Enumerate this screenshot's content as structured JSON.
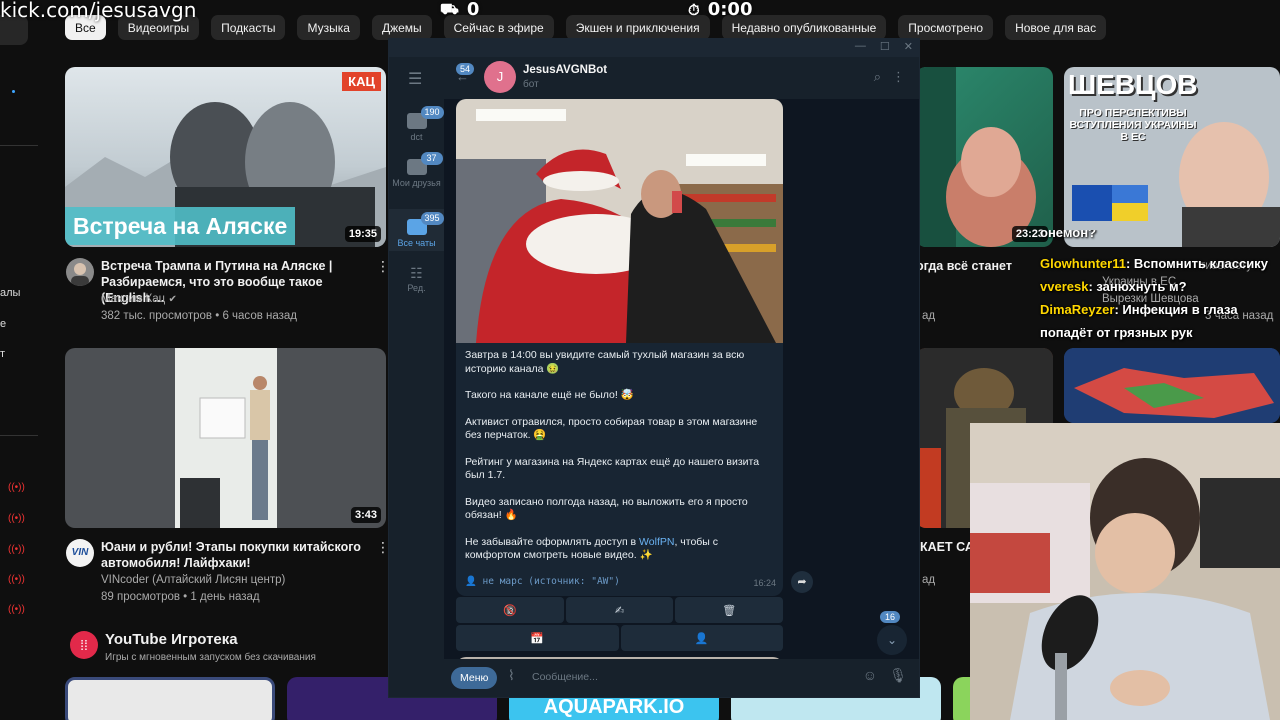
{
  "overlay": {
    "url": "kick.com/jesusavgn",
    "counter": "0",
    "timer": "0:00",
    "counter_icon": "user-icon",
    "timer_icon": "stopwatch-icon"
  },
  "yt": {
    "chips": [
      "Все",
      "Видеоигры",
      "Подкасты",
      "Музыка",
      "Джемы",
      "Сейчас в эфире",
      "Экшен и приключения",
      "Недавно опубликованные",
      "Просмотрено",
      "Новое для вас"
    ],
    "sidebar_frag": {
      "a": "алы",
      "b": "е",
      "c": "т"
    },
    "videos": [
      {
        "thumb_badge": "КАЦ",
        "thumb_caption": "Встреча на Аляске",
        "duration": "19:35",
        "title": "Встреча Трампа и Путина на Аляске | Разбираемся, что это вообще такое (English ...",
        "channel": "Максим Кац",
        "meta": "382 тыс. просмотров • 6 часов назад"
      },
      {
        "duration": "3:43",
        "title": "Юани и рубли! Этапы покупки китайского автомобиля! Лайфхаки!",
        "channel": "VINcoder (Алтайский Лисян центр)",
        "meta": "89 просмотров • 1 день назад"
      }
    ],
    "right": {
      "duration": "23:23",
      "thumb_title": "ШЕВЦОВ",
      "thumb_sub": "ПРО ПЕРСПЕКТИВЫ ВСТУПЛЕНИЯ УКРАИНЫ В ЕС",
      "frag_title": "огда всё станет",
      "frag_meta": "ад",
      "frag2": "тивы всту",
      "frag2b": "Украины в ЕС",
      "channel": "Вырезки Шевцова",
      "meta": "3 часа назад",
      "frag3": "КАЕТ СА",
      "frag3_meta": "ад"
    },
    "playables": {
      "title": "YouTube Игротека",
      "subtitle": "Игры с мгновенным запуском без скачивания",
      "tiles": [
        "",
        "",
        "AQUAPARK.IO",
        "",
        ""
      ]
    }
  },
  "telegram": {
    "rail": [
      {
        "label": "dct",
        "badge": "190"
      },
      {
        "label": "Мои друзья",
        "badge": "37"
      },
      {
        "label": "Все чаты",
        "badge": "395"
      },
      {
        "label": "Ред.",
        "badge": ""
      }
    ],
    "back_badge": "54",
    "bot": {
      "initial": "J",
      "name": "JesusAVGNBot",
      "status": "бот"
    },
    "message": {
      "p1": "Завтра в 14:00 вы увидите самый тухлый магазин за всю историю канала 🤢",
      "p2": "Такого на канале ещё не было! 🤯",
      "p3": "Активист отравился, просто собирая товар в этом магазине без перчаток. 🤮",
      "p4": "Рейтинг у магазина на Яндекс картах ещё до нашего визита был 1.7.",
      "p5": "Видео записано полгода назад, но выложить его я просто обязан! 🔥",
      "p6_pre": "Не забывайте оформлять доступ в ",
      "p6_link": "WolfPN",
      "p6_post": ", чтобы с комфортом смотреть новые видео. ✨",
      "signature": "👤 не марс (источник: \"AW\")",
      "time": "16:24"
    },
    "keyboard": [
      [
        "🔞",
        "✍",
        "🗑"
      ],
      [
        "📅",
        "👤"
      ]
    ],
    "scroll_badge": "16",
    "input": {
      "menu": "Меню",
      "placeholder": "Сообщение..."
    }
  },
  "stream_chat": [
    {
      "user": "",
      "text": "онемон?"
    },
    {
      "user": "Glowhunter11",
      "text": ": Вспомнить классику"
    },
    {
      "user": "vveresk",
      "text": ": занюхнуть м?"
    },
    {
      "user": "DimaReyzer",
      "text": ": Инфекция в глаза попадёт от грязных рук"
    }
  ]
}
